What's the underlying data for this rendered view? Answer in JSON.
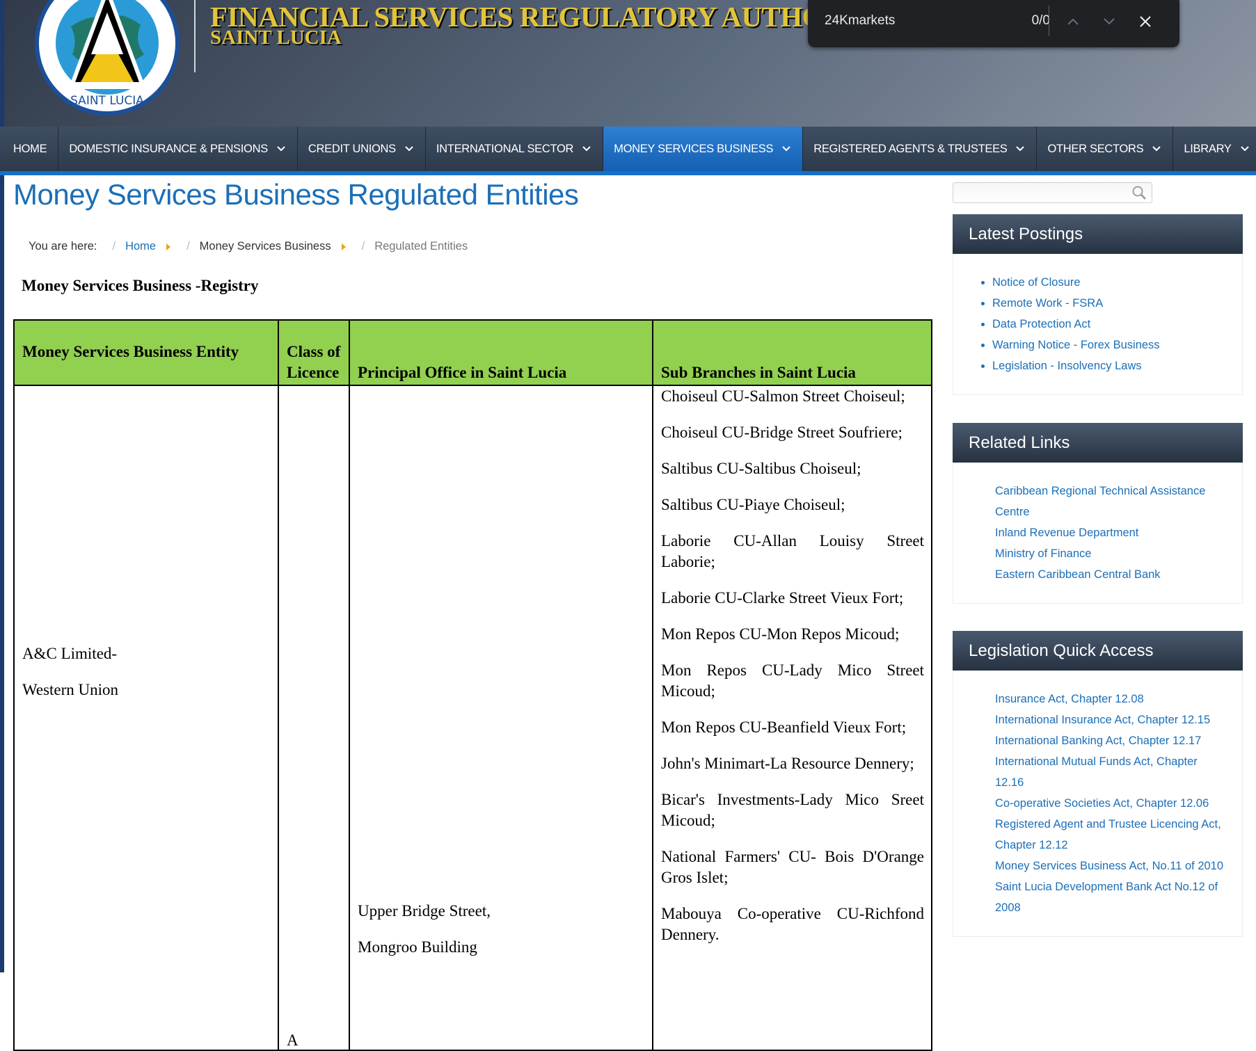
{
  "header": {
    "org_title": "FINANCIAL SERVICES  REGULATORY AUTHORITY",
    "org_subtitle": "SAINT LUCIA",
    "logo_text": "FINANCIAL SERVICES REGULATORY AUTHORITY · SAINT LUCIA"
  },
  "find_bar": {
    "query": "24Kmarkets",
    "count": "0/0"
  },
  "nav": {
    "items": [
      {
        "label": "HOME",
        "has_dropdown": false,
        "active": false
      },
      {
        "label": "DOMESTIC INSURANCE & PENSIONS",
        "has_dropdown": true,
        "active": false
      },
      {
        "label": "CREDIT UNIONS",
        "has_dropdown": true,
        "active": false
      },
      {
        "label": "INTERNATIONAL SECTOR",
        "has_dropdown": true,
        "active": false
      },
      {
        "label": "MONEY SERVICES BUSINESS",
        "has_dropdown": true,
        "active": true
      },
      {
        "label": "REGISTERED AGENTS & TRUSTEES",
        "has_dropdown": true,
        "active": false
      },
      {
        "label": "OTHER SECTORS",
        "has_dropdown": true,
        "active": false
      },
      {
        "label": "LIBRARY",
        "has_dropdown": true,
        "active": false
      }
    ]
  },
  "page": {
    "title": "Money Services Business Regulated Entities",
    "breadcrumb": {
      "prefix": "You are here:",
      "home": "Home",
      "section": "Money Services Business",
      "current": "Regulated Entities"
    },
    "registry_heading": "Money Services Business -Registry"
  },
  "table": {
    "headers": {
      "entity": "Money Services Business Entity",
      "class": "Class of Licence",
      "office": "Principal Office in Saint Lucia",
      "branches": "Sub Branches in Saint Lucia"
    },
    "row": {
      "entity_line1": "A&C Limited-",
      "entity_line2": "Western Union",
      "class": "A",
      "office_line1": "Upper Bridge Street,",
      "office_line2": "Mongroo Building",
      "branches": [
        "Choiseul CU-Salmon Street Choiseul;",
        "Choiseul CU-Bridge Street Soufriere;",
        "Saltibus CU-Saltibus Choiseul;",
        "Saltibus CU-Piaye Choiseul;",
        "Laborie CU-Allan Louisy Street Laborie;",
        "Laborie CU-Clarke Street Vieux Fort;",
        "Mon Repos CU-Mon Repos Micoud;",
        "Mon Repos CU-Lady Mico Street Micoud;",
        "Mon Repos CU-Beanfield Vieux Fort;",
        "John's Minimart-La Resource Dennery;",
        "Bicar's Investments-Lady Mico Sreet Micoud;",
        "National Farmers' CU- Bois D'Orange Gros Islet;",
        "Mabouya Co-operative CU-Richfond Dennery."
      ]
    }
  },
  "sidebar": {
    "latest_postings": {
      "title": "Latest Postings",
      "items": [
        "Notice of Closure",
        "Remote Work - FSRA",
        "Data Protection Act",
        "Warning Notice - Forex Business",
        "Legislation - Insolvency Laws"
      ]
    },
    "related_links": {
      "title": "Related Links",
      "items": [
        "Caribbean Regional Technical Assistance Centre",
        "Inland Revenue Department",
        "Ministry of Finance",
        "Eastern Caribbean Central Bank"
      ]
    },
    "legislation": {
      "title": "Legislation Quick Access",
      "items": [
        "Insurance Act, Chapter 12.08",
        "International Insurance Act, Chapter 12.15",
        "International Banking Act, Chapter 12.17",
        "International Mutual Funds Act, Chapter 12.16",
        "Co-operative Societies Act, Chapter 12.06",
        "Registered Agent and Trustee Licencing Act, Chapter 12.12",
        "Money Services Business Act, No.11 of 2010",
        "Saint Lucia Development Bank Act No.12 of 2008"
      ]
    }
  },
  "colors": {
    "link_blue": "#1b6fb8",
    "table_header_green": "#92d050",
    "nav_active": "#1a67bd",
    "title_gold": "#e1c43a"
  }
}
